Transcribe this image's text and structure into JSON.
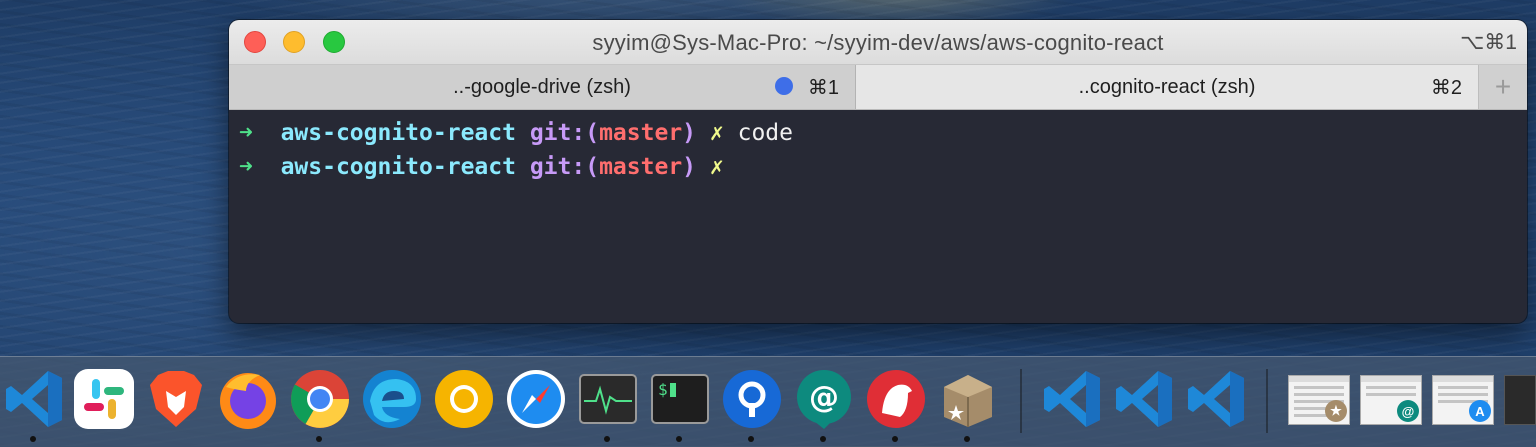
{
  "window": {
    "title": "syyim@Sys-Mac-Pro: ~/syyim-dev/aws/aws-cognito-react",
    "title_shortcut": "⌥⌘1",
    "tabs": [
      {
        "label": "..-google-drive (zsh)",
        "shortcut": "⌘1"
      },
      {
        "label": "..cognito-react (zsh)",
        "shortcut": "⌘2"
      }
    ],
    "new_tab_label": "+"
  },
  "terminal": {
    "lines": [
      {
        "arrow": "➜",
        "dir": "aws-cognito-react",
        "git": "git:(",
        "branch": "master",
        "git_close": ")",
        "dirty": "✗",
        "command": "code"
      },
      {
        "arrow": "➜",
        "dir": "aws-cognito-react",
        "git": "git:(",
        "branch": "master",
        "git_close": ")",
        "dirty": "✗",
        "command": ""
      }
    ]
  },
  "dock": {
    "apps": [
      {
        "name": "vscode-icon",
        "running": true
      },
      {
        "name": "slack-icon",
        "running": false
      },
      {
        "name": "brave-icon",
        "running": false
      },
      {
        "name": "firefox-icon",
        "running": false
      },
      {
        "name": "chrome-icon",
        "running": true
      },
      {
        "name": "edge-icon",
        "running": false
      },
      {
        "name": "chrome-canary-icon",
        "running": false
      },
      {
        "name": "safari-icon",
        "running": false
      },
      {
        "name": "activity-monitor-icon",
        "running": true
      },
      {
        "name": "terminal-icon",
        "running": true
      },
      {
        "name": "pritunl-icon",
        "running": true
      },
      {
        "name": "mail-at-icon",
        "running": true
      },
      {
        "name": "bear-icon",
        "running": true
      },
      {
        "name": "archive-box-icon",
        "running": true
      },
      {
        "name": "vscode-insiders-icon-1",
        "running": false
      },
      {
        "name": "vscode-insiders-icon-2",
        "running": false
      },
      {
        "name": "vscode-insiders-icon-3",
        "running": false
      }
    ],
    "terminal_icon_text": "$"
  },
  "colors": {
    "terminal_bg": "#272935",
    "arrow": "#4fe08a",
    "dir": "#8be9fd",
    "git": "#c79af7",
    "branch": "#ff6e6e",
    "dirty": "#f1fa8c",
    "tab_dot": "#3e6ee8"
  }
}
